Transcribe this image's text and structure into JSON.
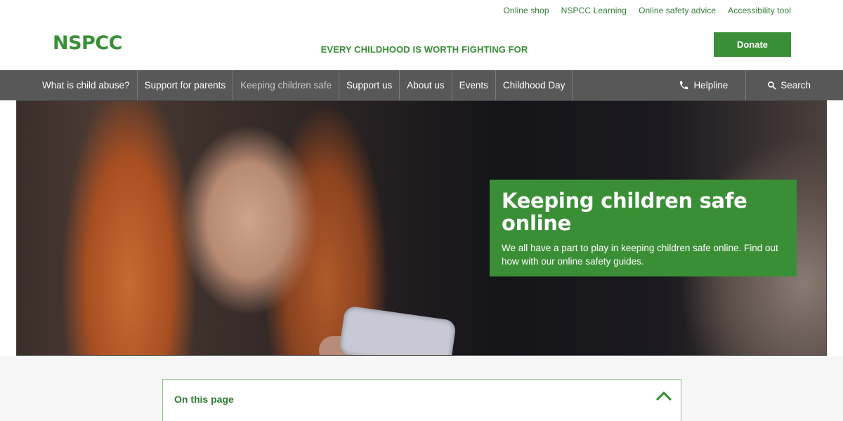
{
  "utility_links": [
    "Online shop",
    "NSPCC Learning",
    "Online safety advice",
    "Accessibility tool"
  ],
  "header": {
    "logo": "NSPCC",
    "tagline": "EVERY CHILDHOOD IS WORTH FIGHTING FOR",
    "donate_label": "Donate"
  },
  "nav": {
    "items": [
      {
        "label": "What is child abuse?"
      },
      {
        "label": "Support for parents"
      },
      {
        "label": "Keeping children safe"
      },
      {
        "label": "Support us"
      },
      {
        "label": "About us"
      },
      {
        "label": "Events"
      },
      {
        "label": "Childhood Day"
      }
    ],
    "active_item": "Keeping children safe",
    "helpline_label": "Helpline",
    "search_label": "Search"
  },
  "hero": {
    "title": "Keeping children safe online",
    "text": "We all have a part to play in keeping children safe online. Find out how with our online safety guides."
  },
  "on_this_page": {
    "title": "On this page",
    "toggle_icon": "chevron-up-icon"
  },
  "colors": {
    "brand_green": "#3a8f36",
    "nav_bg": "#585858"
  }
}
